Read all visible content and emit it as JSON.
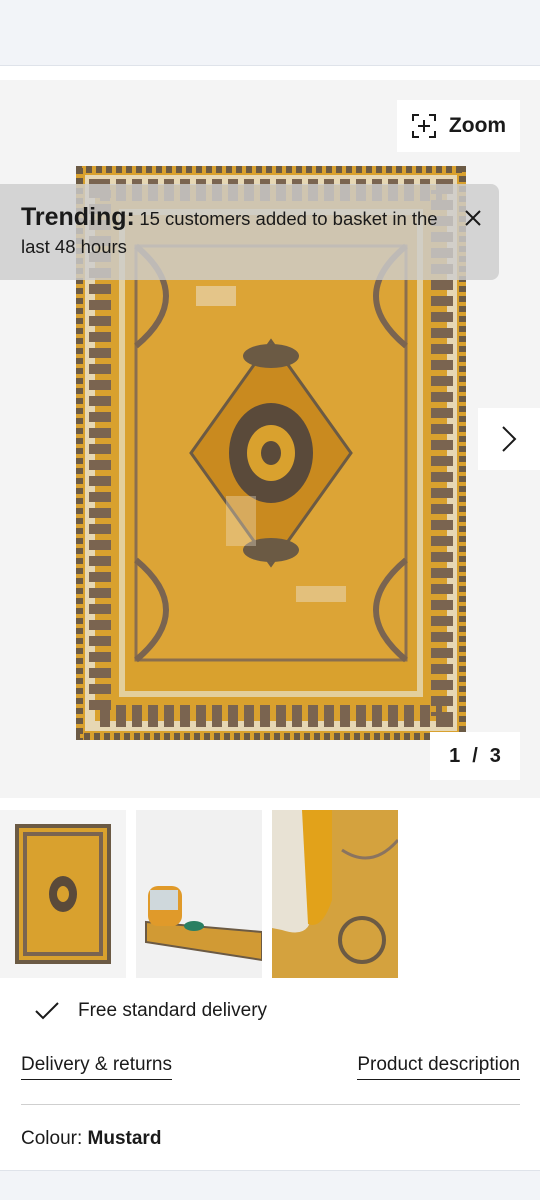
{
  "gallery": {
    "zoom_label": "Zoom",
    "counter_current": "1",
    "counter_sep": "/",
    "counter_total": "3"
  },
  "trending": {
    "heading": "Trending:",
    "message": "15 customers added to basket in the last 48 hours"
  },
  "delivery": {
    "free_text": "Free standard delivery"
  },
  "links": {
    "delivery_returns": "Delivery & returns",
    "product_description": "Product description"
  },
  "colour": {
    "label": "Colour:",
    "value": "Mustard"
  },
  "colors": {
    "rug_mustard": "#d9a12e",
    "rug_dark": "#5a4a3a",
    "rug_cream": "#e8dcc0"
  }
}
